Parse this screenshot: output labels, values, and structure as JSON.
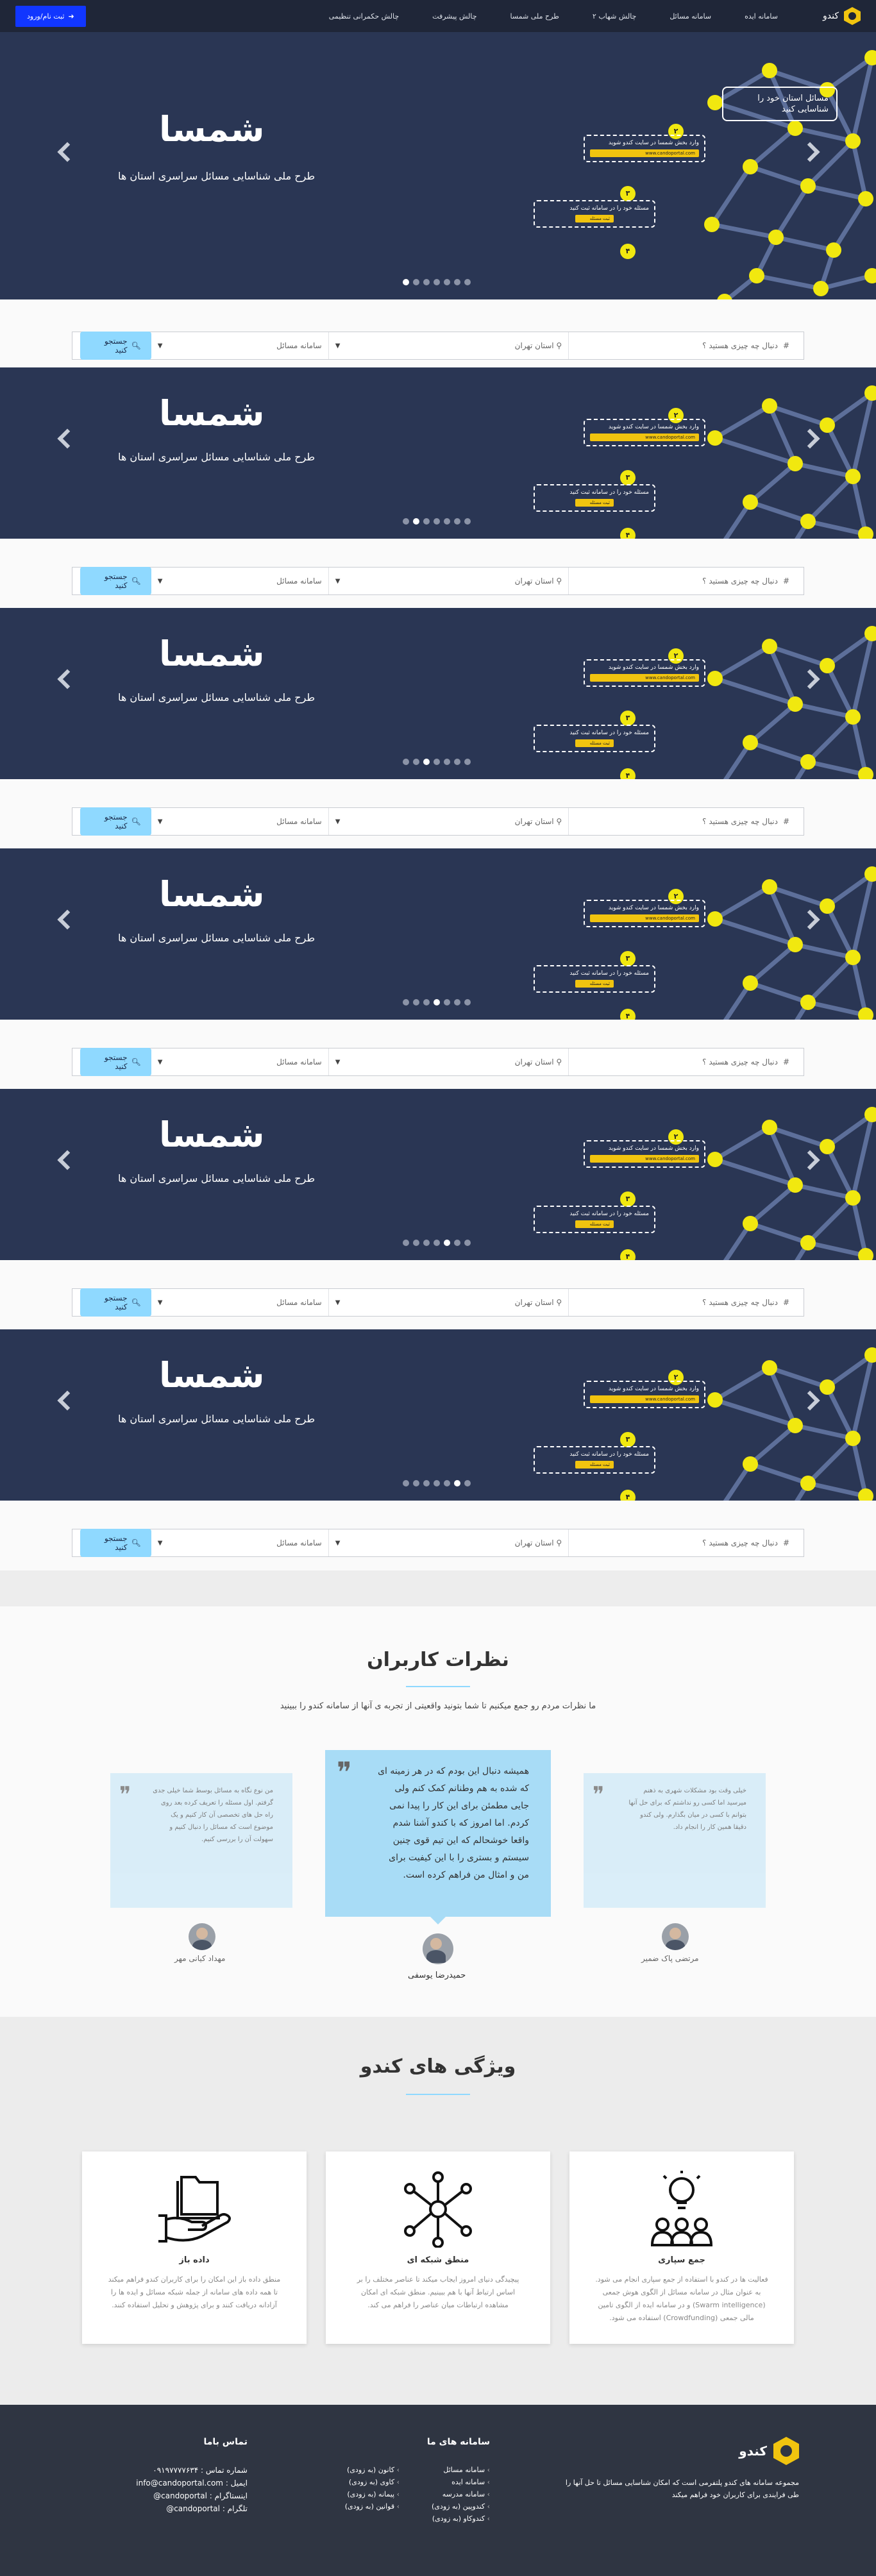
{
  "nav": {
    "brand": "کندو",
    "items": [
      "سامانه ایده",
      "سامانه مسائل",
      "چالش شهاب ۲",
      "طرح ملی شمسا",
      "چالش پیشرفت",
      "چالش حکمرانی تنظیمی"
    ],
    "login": "ثبت نام/ورود"
  },
  "hero": {
    "title": "شمسا",
    "subtitle": "طرح ملی شناسایی مسائل سراسری استان ها",
    "top_note": "مسائل استان خود را شناسایی کنید",
    "step2_text": "وارد بخش شمسا در سایت کندو شوید",
    "step2_url": "www.candoportal.com",
    "step3_text": "مسئله خود را در سامانه ثبت کنید",
    "step3_button": "ثبت مسئله",
    "step_numbers": [
      "۲",
      "۳",
      "۴"
    ],
    "dot_count": 7,
    "active_dots": [
      6,
      5,
      4,
      3,
      2,
      1
    ]
  },
  "search": {
    "query_placeholder": "دنبال چه چیزی هستید ؟",
    "location": "استان تهران",
    "category": "سامانه مسائل",
    "button": "جستجو کنید"
  },
  "reviews": {
    "title": "نظرات کاربران",
    "subtitle": "ما نظرات مردم رو جمع میکنیم تا شما بتونید واقعیتی از تجربه ی آنها از سامانه کندو را ببینید",
    "items": [
      {
        "text": "خیلی وقت بود مشکلات شهری به ذهنم میرسید اما کسی رو نداشتم که برای حل آنها بتوانم با کسی در میان بگذارم. ولی کندو دقیقا همین کار را انجام داد.",
        "name": "مرتضی پاک ضمیر"
      },
      {
        "text": "همیشه دنبال این بودم که در هر زمینه ای که شده به هم وطنانم کمک کنم ولی جایی مطمئن برای این کار را پیدا نمی کردم. اما امروز که با کندو آشنا شدم واقعا خوشحالم که این تیم قوی چنین سیستم و بستری را با این کیفیت برای من و امثال من فراهم کرده است.",
        "name": "حمیدرضا یوسفی"
      },
      {
        "text": "من نوع نگاه به مسائل بوسط شما خیلی جدی گرفتم. اول مسئله را تعریف کرده بعد روی راه حل های تخصصی آن کار کنیم و یک موضوع است که مسائل را دنبال کنیم و سهولت آن را بررسی کنیم.",
        "name": "مهداد کیانی مهر"
      }
    ]
  },
  "features": {
    "title": "ویژگی های کندو",
    "items": [
      {
        "title": "جمع سپاری",
        "text": "فعالیت ها در کندو با استفاده از جمع سپاری انجام می شود. به عنوان مثال در سامانه مسائل از الگوی هوش جمعی (Swarm intelligence) و در سامانه ایده از الگوی تامین مالی جمعی (Crowdfunding) استفاده می شود.",
        "icon": "people-bulb-icon"
      },
      {
        "title": "منطق شبکه ای",
        "text": "پیچیدگی دنیای امروز ایجاب میکند تا عناصر مختلف را بر اساس ارتباط آنها با هم ببینیم. منطق شبکه ای امکان مشاهده ارتباطات میان عناصر را فراهم می کند.",
        "icon": "network-icon"
      },
      {
        "title": "داده باز",
        "text": "منطق داده باز این امکان را برای کاربران کندو فراهم میکند تا همه داده های سامانه از جمله شبکه مسائل و ایده ها را آزادانه دریافت کنند و برای پژوهش و تحلیل استفاده کنند.",
        "icon": "open-folder-icon"
      }
    ]
  },
  "footer": {
    "brand": "کندو",
    "about": "مجموعه سامانه های کندو پلتفرمی است که امکان شناسایی مسائل تا حل آنها را طی فرایندی برای کاربران خود فراهم میکند",
    "links_title": "سامانه های ما",
    "links_col1": [
      "سامانه مسائل",
      "سامانه ایده",
      "سامانه مدرسه",
      "کندوپین (به زودی)",
      "کندوکاو (به زودی)"
    ],
    "links_col2": [
      "کانون (به زودی)",
      "کاوی (به زودی)",
      "پیمانه (به زودی)",
      "قوانین (به زودی)"
    ],
    "contact_title": "تماس باما",
    "phone": "شماره تماس : ۰۹۱۹۷۷۷۷۶۳۴",
    "email": "ایمیل : info@candoportal.com",
    "instagram": "اینستاگرام : candoportal@",
    "telegram": "تلگرام : candoportal@"
  }
}
